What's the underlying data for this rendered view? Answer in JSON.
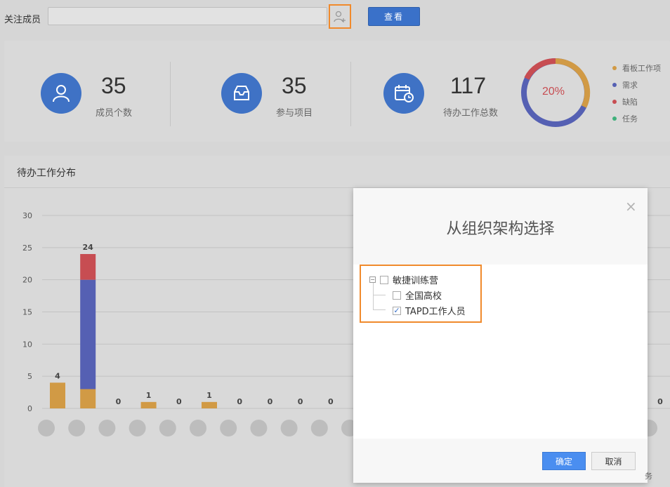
{
  "top": {
    "follow_label": "关注成员",
    "follow_input_value": "",
    "view_button": "查看"
  },
  "stats": [
    {
      "value": "35",
      "label": "成员个数",
      "icon": "user-icon"
    },
    {
      "value": "35",
      "label": "参与项目",
      "icon": "inbox-icon"
    },
    {
      "value": "117",
      "label": "待办工作总数",
      "icon": "calendar-clock-icon"
    }
  ],
  "donut": {
    "center_label": "20%",
    "legend": [
      {
        "label": "看板工作项",
        "color": "#d19a45"
      },
      {
        "label": "需求",
        "color": "#5560b3"
      },
      {
        "label": "缺陷",
        "color": "#c74d52"
      },
      {
        "label": "任务",
        "color": "#3fb07a"
      }
    ]
  },
  "chart_title": "待办工作分布",
  "chart_data": {
    "type": "bar",
    "stacked": true,
    "ylim": [
      0,
      30
    ],
    "yticks": [
      "0",
      "5",
      "10",
      "15",
      "20",
      "25",
      "30"
    ],
    "categories": [
      "",
      "",
      "",
      "",
      "",
      "",
      "",
      "",
      "",
      "",
      "",
      "",
      "",
      "",
      "",
      "",
      "",
      "",
      "",
      ""
    ],
    "totals": [
      "4",
      "24",
      "0",
      "1",
      "0",
      "1",
      "0",
      "0",
      "0",
      "0",
      "",
      "",
      "",
      "",
      "",
      "",
      "",
      "",
      "",
      "0"
    ],
    "series": [
      {
        "name": "看板工作项",
        "color": "#d19a45",
        "values": [
          4,
          3,
          0,
          1,
          0,
          1,
          0,
          0,
          0,
          0
        ]
      },
      {
        "name": "需求",
        "color": "#5560b3",
        "values": [
          0,
          17,
          0,
          0,
          0,
          0,
          0,
          0,
          0,
          0
        ]
      },
      {
        "name": "缺陷",
        "color": "#c74d52",
        "values": [
          0,
          4,
          0,
          0,
          0,
          0,
          0,
          0,
          0,
          0
        ]
      }
    ],
    "partial_bar_tail": "务"
  },
  "modal": {
    "title": "从组织架构选择",
    "close_label": "×",
    "tree": [
      {
        "label": "敏捷训练营",
        "checked": false,
        "level": 0
      },
      {
        "label": "全国高校",
        "checked": false,
        "level": 1
      },
      {
        "label": "TAPD工作人员",
        "checked": true,
        "level": 1
      }
    ],
    "ok_button": "确定",
    "cancel_button": "取消"
  }
}
